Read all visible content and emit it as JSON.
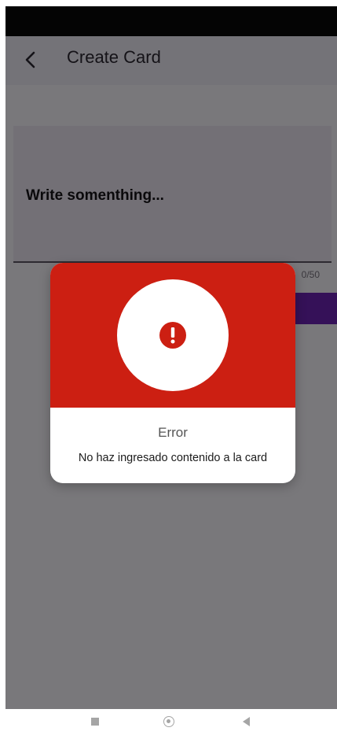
{
  "app_bar": {
    "back_icon": "chevron-left-icon",
    "title": "Create Card"
  },
  "editor": {
    "text": "Write somenthing...",
    "counter": "0/50"
  },
  "dialog": {
    "header_color": "#cc1f12",
    "icon": "exclamation-circle-icon",
    "title": "Error",
    "message": "No haz ingresado contenido a la card"
  },
  "colors": {
    "accent": "#6a23b0",
    "error": "#cc1f12"
  },
  "nav_bar": {
    "icons": [
      "recents-square-icon",
      "home-circle-icon",
      "back-triangle-icon"
    ]
  }
}
